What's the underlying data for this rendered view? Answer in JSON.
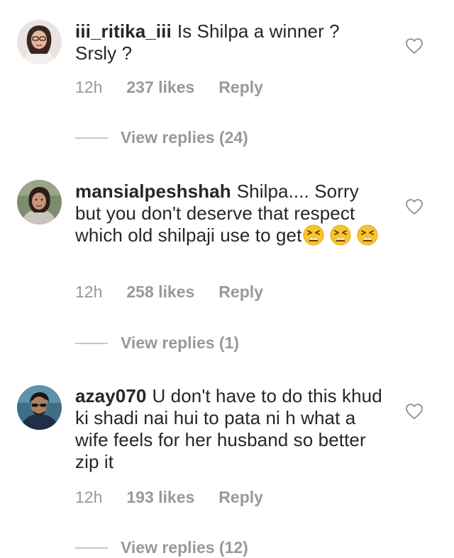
{
  "comments": [
    {
      "username": "iii_ritika_iii",
      "text": "Is Shilpa a winner ?\nSrsly ?",
      "time": "12h",
      "likes": "237 likes",
      "reply": "Reply",
      "view_replies": "View replies (24)",
      "avatar_icon": "avatar-woman-glasses"
    },
    {
      "username": "mansialpeshshah",
      "text": "Shilpa.... Sorry but you don't deserve that respect which old shilpaji use to get",
      "emojis": [
        "tired-face-emoji",
        "tired-face-emoji",
        "tired-face-emoji"
      ],
      "time": "12h",
      "likes": "258 likes",
      "reply": "Reply",
      "view_replies": "View replies (1)",
      "avatar_icon": "avatar-woman-outdoor"
    },
    {
      "username": "azay070",
      "text": "U don't have to do this khud ki shadi nai hui to pata ni h what a wife feels for her husband so better  zip it",
      "time": "12h",
      "likes": "193 likes",
      "reply": "Reply",
      "view_replies": "View replies (12)",
      "avatar_icon": "avatar-man-blue"
    }
  ],
  "icons": {
    "like": "heart-outline-icon"
  },
  "colors": {
    "text": "#262626",
    "meta": "#999999",
    "divider": "#c7c7c7",
    "emoji": "#f7c52b"
  }
}
